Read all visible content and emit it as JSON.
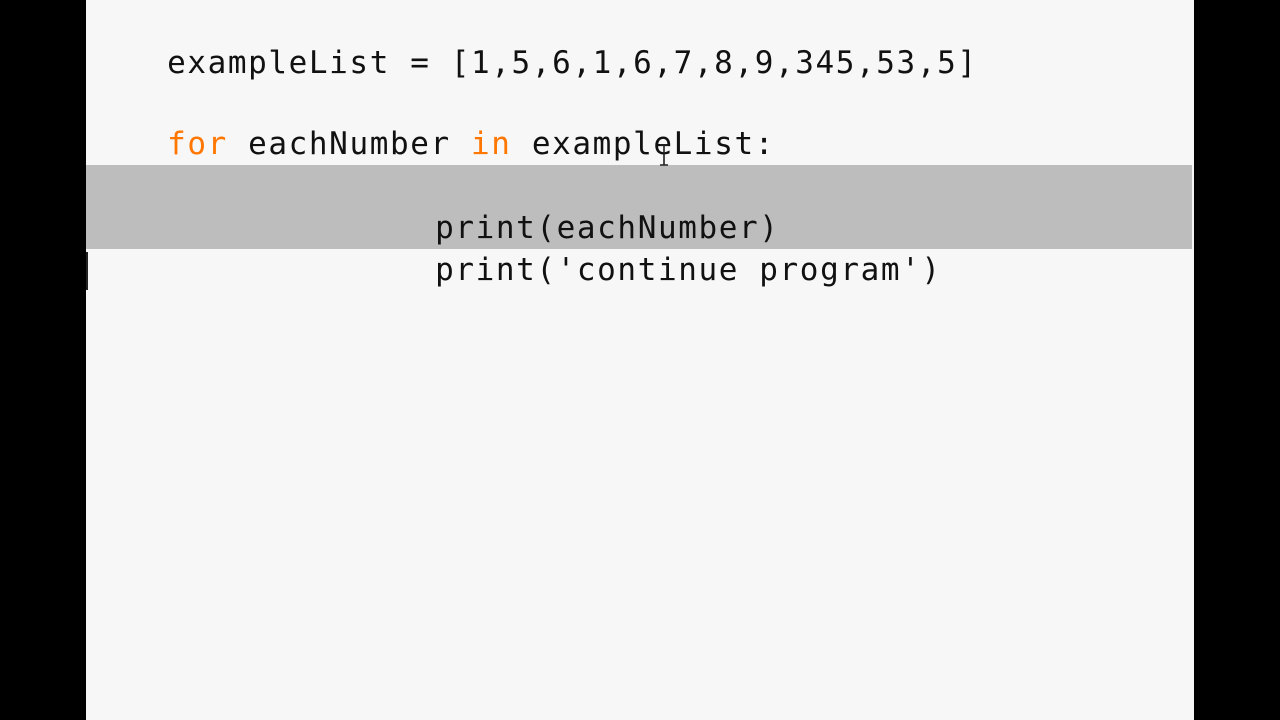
{
  "editor": {
    "lines": [
      {
        "segments": [
          {
            "text": "exampleList = [1,5,6,1,6,7,8,9,345,53,5]",
            "kind": "plain"
          }
        ]
      },
      {
        "segments": []
      },
      {
        "segments": [
          {
            "text": "for",
            "kind": "keyword"
          },
          {
            "text": " eachNumber ",
            "kind": "plain"
          },
          {
            "text": "in",
            "kind": "keyword"
          },
          {
            "text": " exampleList:",
            "kind": "plain"
          }
        ]
      },
      {
        "segments": []
      },
      {
        "segments": [
          {
            "text": "\t\tprint(eachNumber)",
            "kind": "plain"
          }
        ]
      },
      {
        "segments": [
          {
            "text": "\t\tprint('continue program')",
            "kind": "plain"
          }
        ]
      }
    ],
    "selected_lines": [
      4,
      5
    ],
    "cursor_line": 6
  },
  "colors": {
    "background": "#f7f7f7",
    "keyword": "#ff7700",
    "text": "#111111",
    "selection": "#bdbdbd",
    "letterbox": "#000000"
  },
  "mouse_cursor": {
    "icon": "text-ibeam-cursor-icon"
  }
}
